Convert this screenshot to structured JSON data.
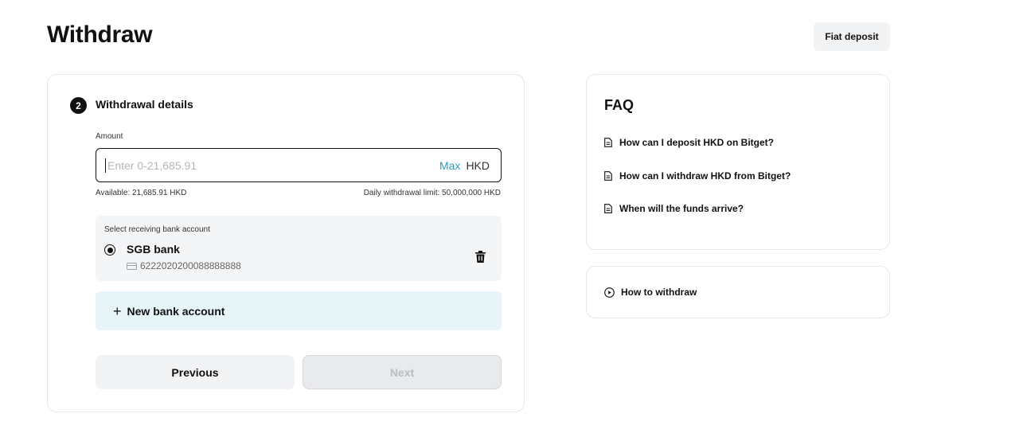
{
  "page": {
    "title": "Withdraw"
  },
  "header": {
    "fiat_deposit_label": "Fiat deposit"
  },
  "withdrawal": {
    "step_number": "2",
    "section_title": "Withdrawal details",
    "amount_label": "Amount",
    "amount_placeholder": "Enter 0-21,685.91",
    "amount_value": "",
    "max_label": "Max",
    "currency": "HKD",
    "available": "Available: 21,685.91 HKD",
    "daily_limit": "Daily withdrawal limit: 50,000,000 HKD",
    "bank_select_label": "Select receiving bank account",
    "bank": {
      "name": "SGB bank",
      "account_number": "6222020200088888888",
      "selected": true
    },
    "new_bank_label": "New bank account",
    "previous_label": "Previous",
    "next_label": "Next"
  },
  "faq": {
    "title": "FAQ",
    "items": [
      "How can I deposit HKD on Bitget?",
      "How can I withdraw HKD from Bitget?",
      "When will the funds arrive?"
    ]
  },
  "how_to": {
    "label": "How to withdraw"
  },
  "icons": {
    "faq_item": "document-icon",
    "how_to": "play-circle-icon",
    "bank_card": "bank-card-icon",
    "delete": "trash-icon",
    "add": "plus-icon"
  },
  "colors": {
    "accent": "#2b9fbd",
    "new_bank_bg": "#e7f5f9",
    "panel_bg": "#f4f5f7"
  }
}
